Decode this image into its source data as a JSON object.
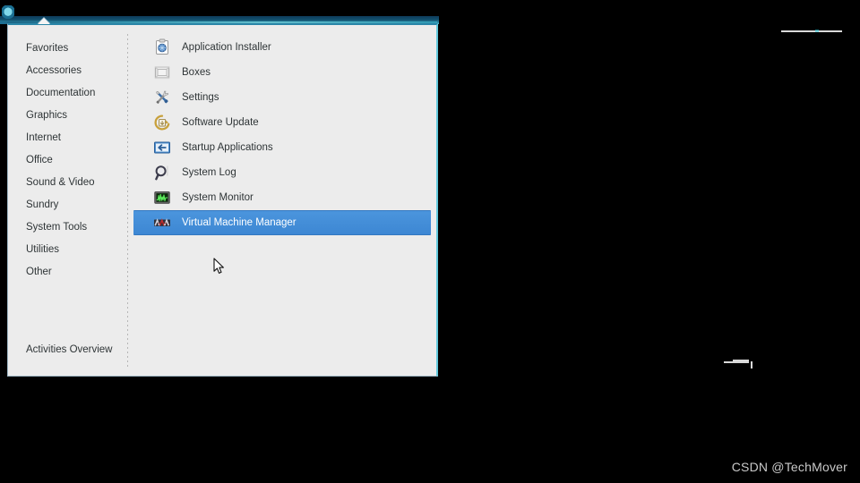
{
  "desktop": {
    "background_color": "#000000",
    "watermark": "CSDN @TechMover"
  },
  "panel": {
    "accent_color": "#2a86a8",
    "highlight_color": "#63c9dd"
  },
  "menu": {
    "background_color": "#ececec",
    "selection_color": "#4a90d9",
    "text_color": "#2e3436",
    "categories": [
      {
        "label": "Favorites",
        "name": "favorites"
      },
      {
        "label": "Accessories",
        "name": "accessories"
      },
      {
        "label": "Documentation",
        "name": "documentation"
      },
      {
        "label": "Graphics",
        "name": "graphics"
      },
      {
        "label": "Internet",
        "name": "internet"
      },
      {
        "label": "Office",
        "name": "office"
      },
      {
        "label": "Sound & Video",
        "name": "sound-video"
      },
      {
        "label": "Sundry",
        "name": "sundry"
      },
      {
        "label": "System Tools",
        "name": "system-tools"
      },
      {
        "label": "Utilities",
        "name": "utilities"
      },
      {
        "label": "Other",
        "name": "other"
      }
    ],
    "activities_overview_label": "Activities Overview",
    "applications": [
      {
        "label": "Application Installer",
        "icon": "application-installer-icon",
        "selected": false
      },
      {
        "label": "Boxes",
        "icon": "boxes-icon",
        "selected": false
      },
      {
        "label": "Settings",
        "icon": "settings-icon",
        "selected": false
      },
      {
        "label": "Software Update",
        "icon": "software-update-icon",
        "selected": false
      },
      {
        "label": "Startup Applications",
        "icon": "startup-applications-icon",
        "selected": false
      },
      {
        "label": "System Log",
        "icon": "system-log-icon",
        "selected": false
      },
      {
        "label": "System Monitor",
        "icon": "system-monitor-icon",
        "selected": false
      },
      {
        "label": "Virtual Machine Manager",
        "icon": "virtual-machine-manager-icon",
        "selected": true
      }
    ]
  }
}
